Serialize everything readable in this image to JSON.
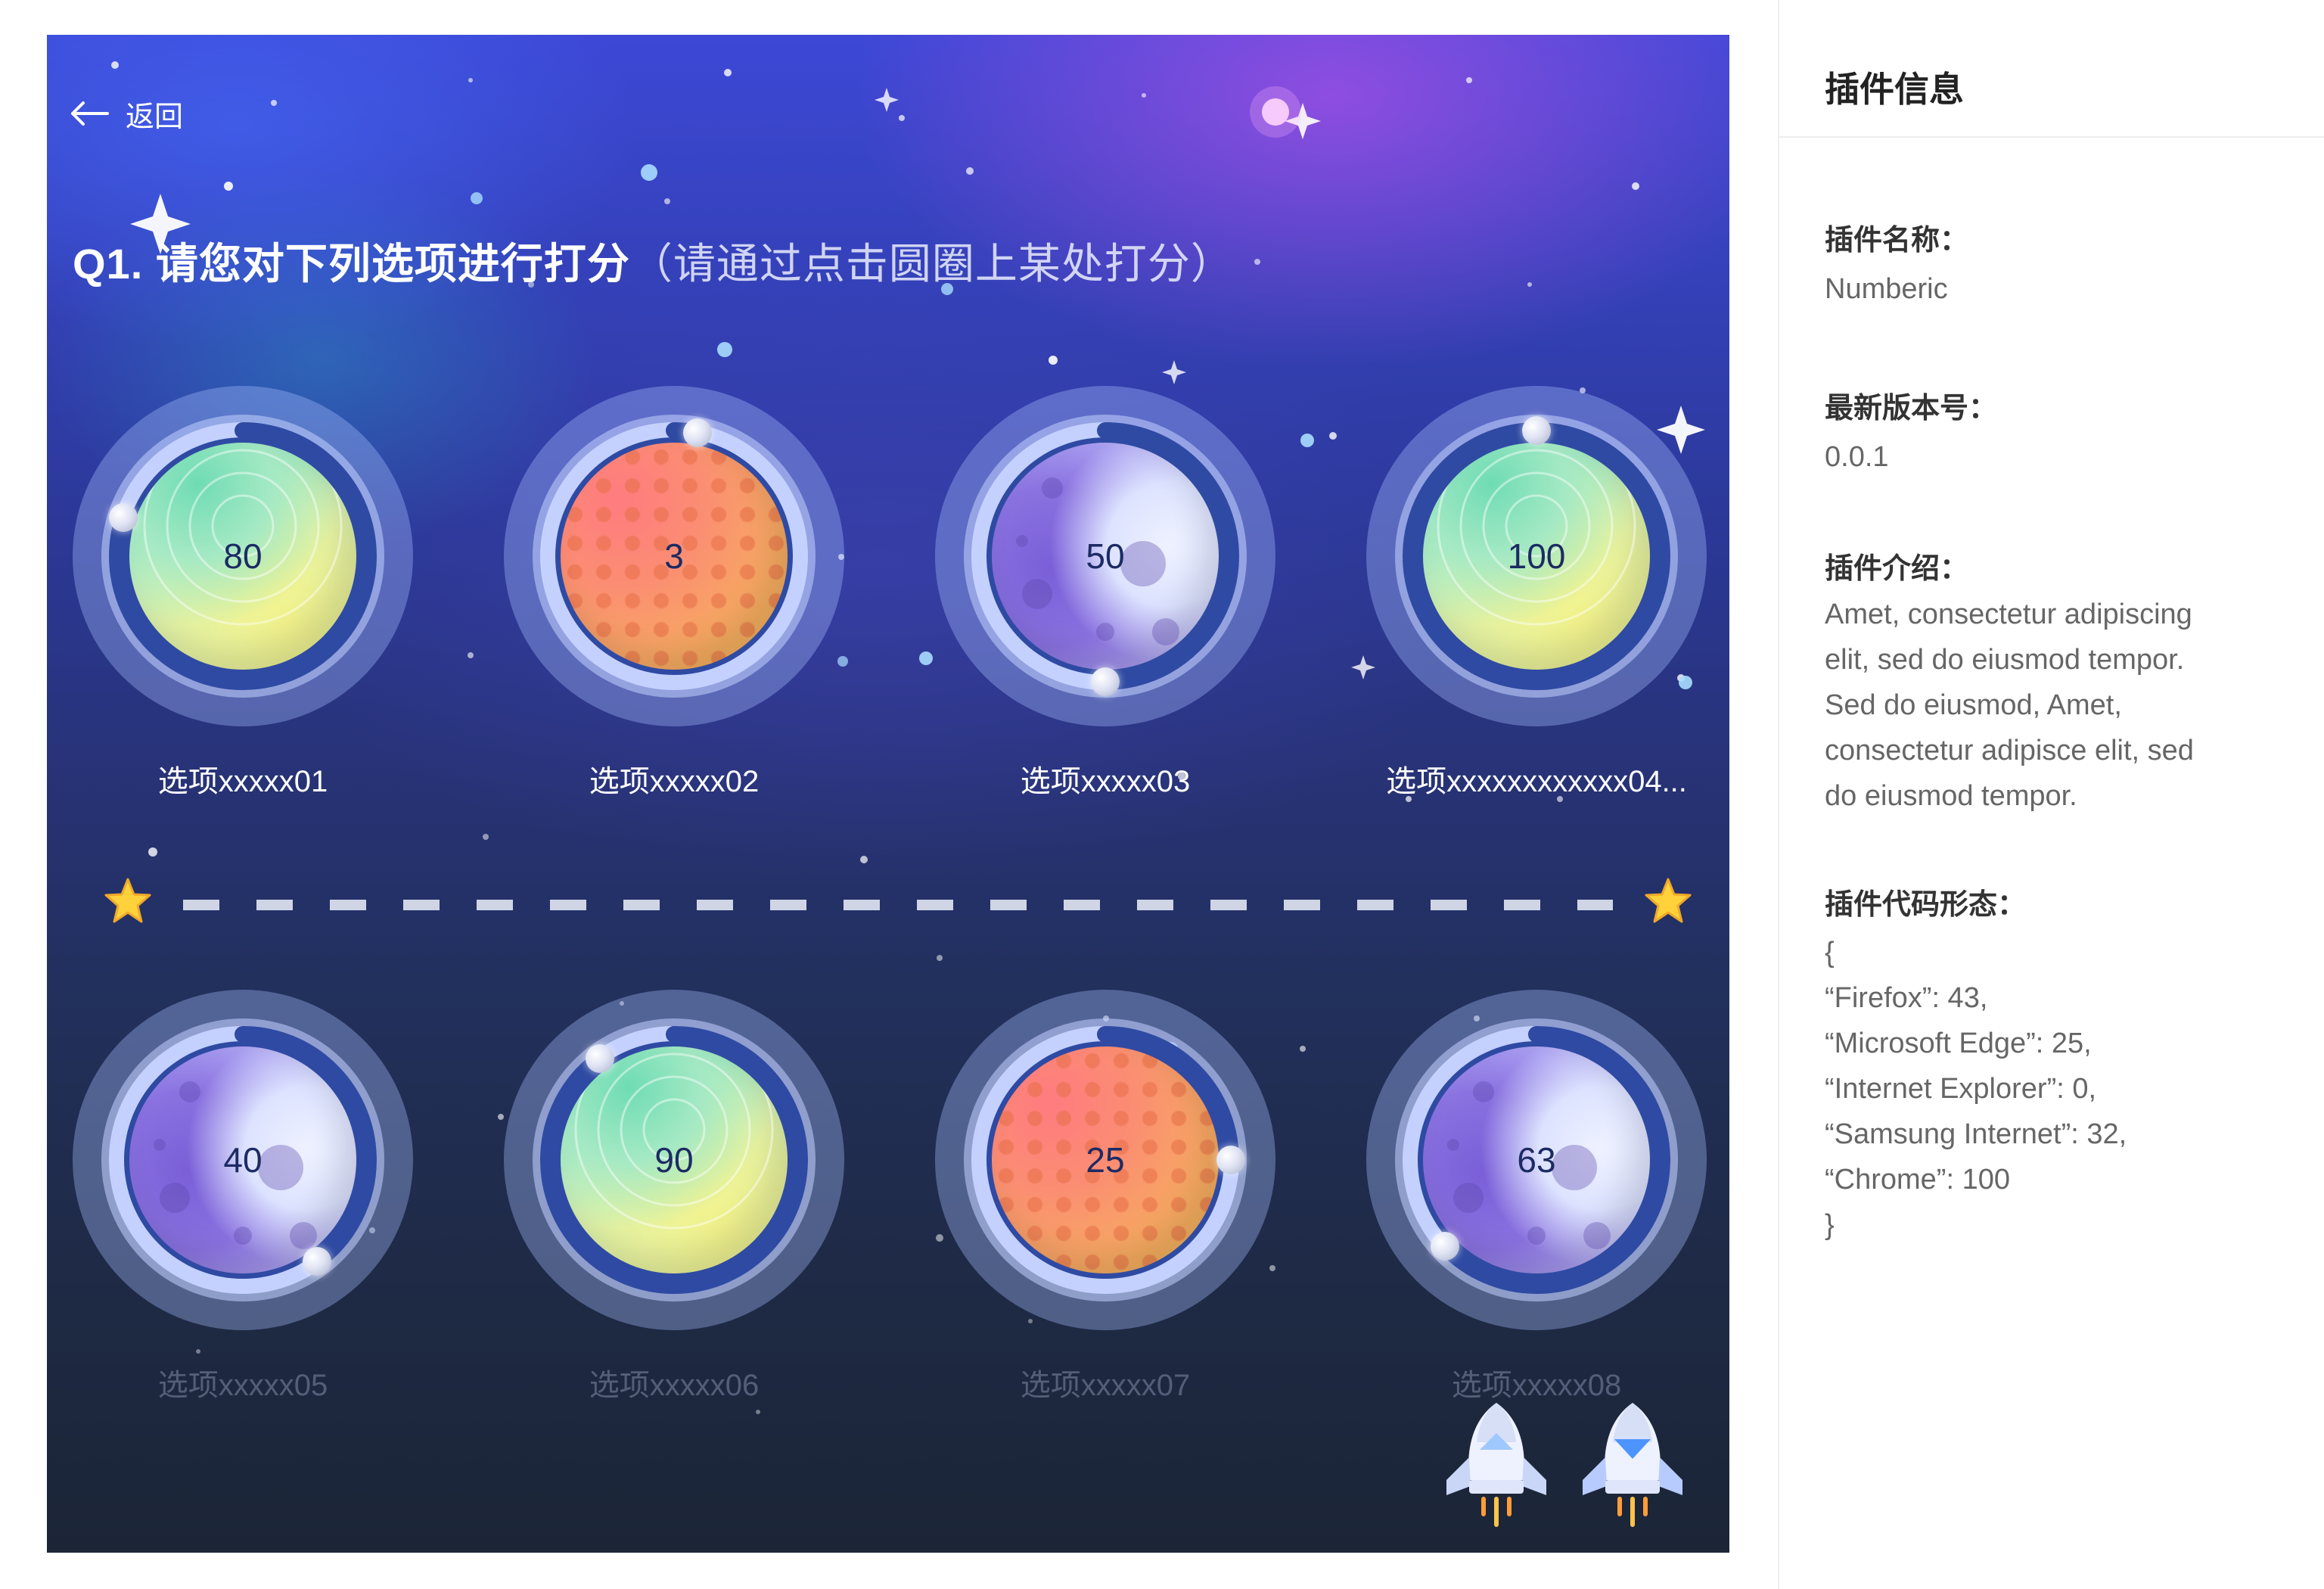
{
  "nav": {
    "back_label": "返回"
  },
  "question": {
    "title": "Q1. 请您对下列选项进行打分",
    "hint": "（请通过点击圆圈上某处打分）"
  },
  "ratings": [
    {
      "label": "选项xxxxx01",
      "score": 80,
      "planet": "green"
    },
    {
      "label": "选项xxxxx02",
      "score": 3,
      "planet": "red"
    },
    {
      "label": "选项xxxxx03",
      "score": 50,
      "planet": "purple"
    },
    {
      "label": "选项xxxxxxxxxxxx04...",
      "score": 100,
      "planet": "green"
    },
    {
      "label": "选项xxxxx05",
      "score": 40,
      "planet": "purple"
    },
    {
      "label": "选项xxxxx06",
      "score": 90,
      "planet": "green"
    },
    {
      "label": "选项xxxxx07",
      "score": 25,
      "planet": "red"
    },
    {
      "label": "选项xxxxx08",
      "score": 63,
      "planet": "purple"
    }
  ],
  "controls": {
    "prev_icon": "rocket-up-icon",
    "next_icon": "rocket-down-icon"
  },
  "panel": {
    "title": "插件信息",
    "name_label": "插件名称：",
    "name_value": "Numberic",
    "version_label": "最新版本号：",
    "version_value": "0.0.1",
    "intro_label": "插件介绍：",
    "intro_lines": [
      "Amet, consectetur adipiscing",
      "elit, sed do eiusmod tempor.",
      "Sed do eiusmod, Amet,",
      "consectetur adipisce elit, sed",
      "do eiusmod tempor."
    ],
    "code_label": "插件代码形态：",
    "code_lines": [
      "{",
      " “Firefox”: 43,",
      " “Microsoft Edge”: 25,",
      " “Internet Explorer”: 0,",
      " “Samsung Internet”: 32,",
      " “Chrome”: 100",
      "}"
    ]
  },
  "colors": {
    "progress": "#2f4aa3",
    "track": "#c4d1ff",
    "label_active": "#ffffff",
    "label_dim": "#6d7590"
  }
}
